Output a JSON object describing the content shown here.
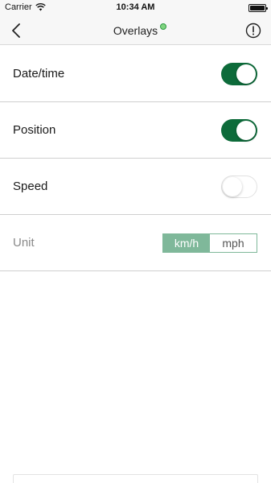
{
  "status_bar": {
    "carrier": "Carrier",
    "time": "10:34 AM",
    "wifi_icon": "wifi-icon",
    "battery_icon": "battery-icon"
  },
  "nav": {
    "title": "Overlays",
    "back_icon": "chevron-left-icon",
    "info_icon": "info-icon",
    "status_dot_color": "#2e9a44"
  },
  "settings": {
    "datetime": {
      "label": "Date/time",
      "enabled": true
    },
    "position": {
      "label": "Position",
      "enabled": true
    },
    "speed": {
      "label": "Speed",
      "enabled": false
    },
    "unit": {
      "label": "Unit",
      "options": [
        "km/h",
        "mph"
      ],
      "selected": "km/h"
    }
  },
  "colors": {
    "accent": "#0d6b3a",
    "segment_accent": "#7fb89a"
  }
}
